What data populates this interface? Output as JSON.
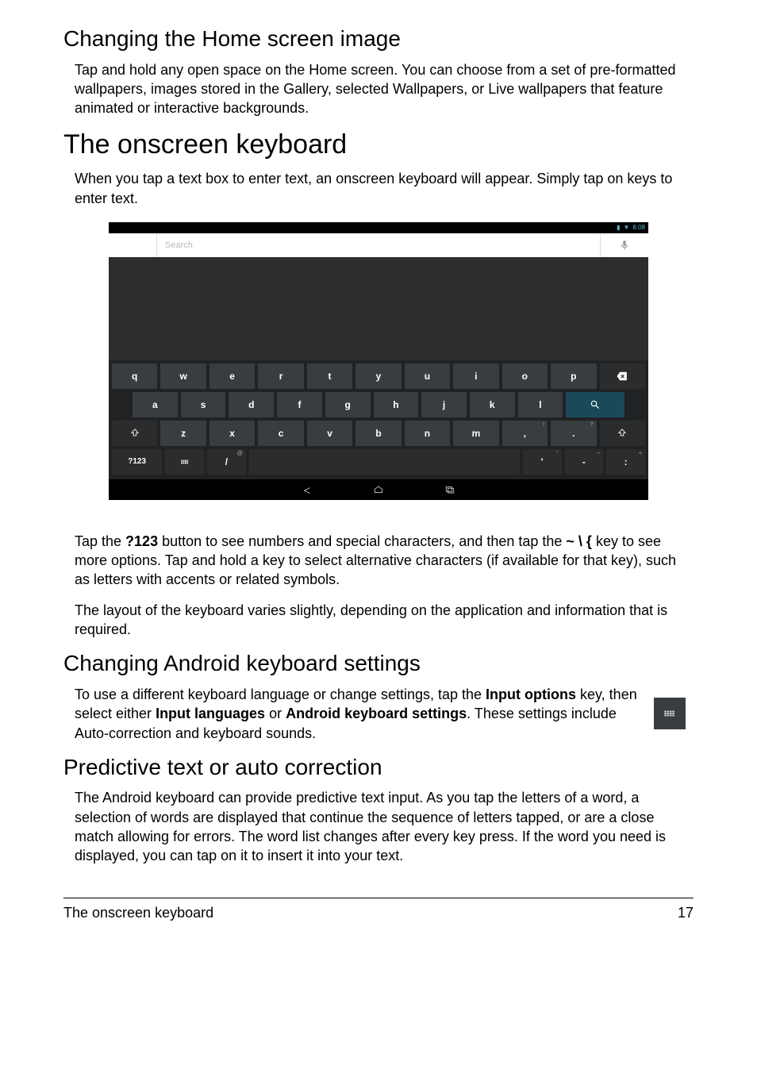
{
  "sections": {
    "changeHome": {
      "title": "Changing the Home screen image",
      "body": "Tap and hold any open space on the Home screen. You can choose from a set of pre-formatted wallpapers, images stored in the Gallery, selected Wallpapers, or Live wallpapers that feature animated or interactive backgrounds."
    },
    "onscreenKeyboard": {
      "title": "The onscreen keyboard",
      "intro": "When you tap a text box to enter text, an onscreen keyboard will appear. Simply tap on keys to enter text.",
      "tapInfo_pre": "Tap the ",
      "tapInfo_bold1": "?123",
      "tapInfo_mid": " button to see numbers and special characters, and then tap the ",
      "tapInfo_bold2": "~ \\ {",
      "tapInfo_post": " key to see more options. Tap and hold a key to select alternative characters (if available for that key), such as letters with accents or related symbols.",
      "layout": "The layout of the keyboard varies slightly, depending on the application and information that is required."
    },
    "changeSettings": {
      "title": "Changing Android keyboard settings",
      "body_pre": "To use a different keyboard language or change settings, tap the ",
      "body_b1": "Input options",
      "body_mid1": " key, then select either ",
      "body_b2": "Input languages",
      "body_mid2": " or ",
      "body_b3": "Android keyboard settings",
      "body_post": ". These settings include Auto-correction and keyboard sounds."
    },
    "predictive": {
      "title": "Predictive text or auto correction",
      "body": "The Android keyboard can provide predictive text input. As you tap the letters of a word, a selection of words are displayed that continue the sequence of letters tapped, or are a close match allowing for errors. The word list changes after every key press. If the word you need is displayed, you can tap on it to insert it into your text."
    }
  },
  "device": {
    "statusTime": "8:08",
    "searchPlaceholder": "Search",
    "keyboard": {
      "row1": [
        "q",
        "w",
        "e",
        "r",
        "t",
        "y",
        "u",
        "i",
        "o",
        "p"
      ],
      "row2": [
        "a",
        "s",
        "d",
        "f",
        "g",
        "h",
        "j",
        "k",
        "l"
      ],
      "row3": [
        "z",
        "x",
        "c",
        "v",
        "b",
        "n",
        "m",
        ",",
        "."
      ],
      "row3_sup": {
        "7": "!",
        "8": "?"
      },
      "row4": {
        "num": "?123",
        "slash": "/",
        "slash_sup": "@",
        "apos": "'",
        "apos_sup": "\"",
        "dash": "-",
        "dash_sup": "~",
        "colon": ":",
        "colon_sup": "+"
      }
    }
  },
  "footer": {
    "title": "The onscreen keyboard",
    "page": "17"
  }
}
